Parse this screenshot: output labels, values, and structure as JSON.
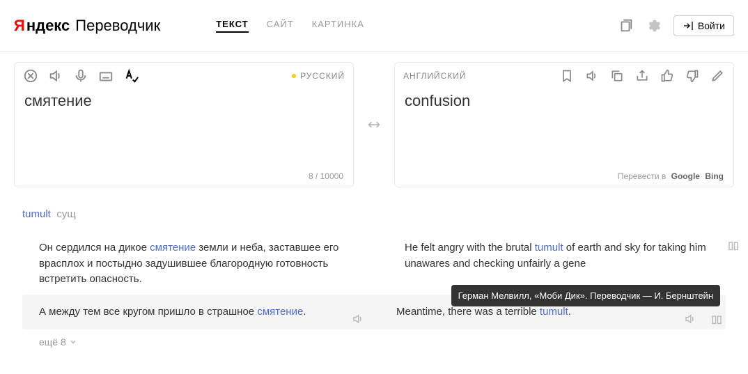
{
  "header": {
    "logo_ya": "Я",
    "logo_rest": "ндекс",
    "logo_sub": "Переводчик",
    "tabs": {
      "text": "ТЕКСТ",
      "site": "САЙТ",
      "image": "КАРТИНКА"
    },
    "login": "Войти"
  },
  "source": {
    "lang": "РУССКИЙ",
    "text": "смятение",
    "counter": "8 / 10000"
  },
  "target": {
    "lang": "АНГЛИЙСКИЙ",
    "text": "confusion",
    "ext_label": "Перевести в",
    "ext_google": "Google",
    "ext_bing": "Bing"
  },
  "dict": {
    "headword": "tumult",
    "pos": "сущ",
    "ex1_src_pre": "Он сердился на дикое ",
    "ex1_src_kw": "смятение",
    "ex1_src_post": " земли и неба, заставшее его врасплох и постыдно задушившее благородную готовность встретить опасность.",
    "ex1_tgt_pre": "He felt angry with the brutal ",
    "ex1_tgt_kw": "tumult",
    "ex1_tgt_post": " of earth and sky for taking him unawares and checking unfairly a gene",
    "ex2_src_pre": "А между тем все кругом пришло в страшное ",
    "ex2_src_kw": "смятение",
    "ex2_src_post": ".",
    "ex2_tgt_pre": "Meantime, there was a terrible ",
    "ex2_tgt_kw": "tumult",
    "ex2_tgt_post": ".",
    "tooltip": "Герман Мелвилл, «Моби Дик». Переводчик — И. Бернштейн",
    "more": "ещё 8"
  }
}
